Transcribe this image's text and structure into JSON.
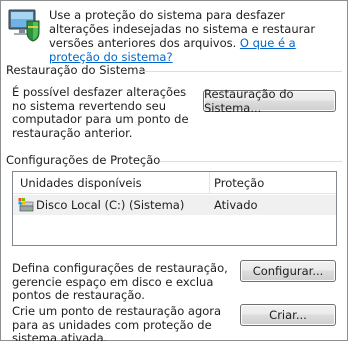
{
  "intro": {
    "text": "Use a proteção do sistema para desfazer alterações indesejadas no sistema e restaurar versões anteriores dos arquivos.",
    "link": "O que é a proteção do sistema?",
    "icon": "system-protection-icon"
  },
  "restore": {
    "title": "Restauração do Sistema",
    "description": "É possível desfazer alterações no sistema revertendo seu computador para um ponto de restauração anterior.",
    "button_label": "Restauração do Sistema..."
  },
  "protection": {
    "title": "Configurações de Proteção",
    "columns": [
      "Unidades disponíveis",
      "Proteção"
    ],
    "drives": [
      {
        "name": "Disco Local (C:) (Sistema)",
        "status": "Ativado",
        "icon": "local-disk-icon"
      }
    ],
    "configure_text": "Defina configurações de restauração, gerencie espaço em disco e exclua pontos de restauração.",
    "configure_label": "Configurar...",
    "create_text": "Crie um ponto de restauração agora para as unidades com proteção de sistema ativada.",
    "create_label": "Criar..."
  },
  "colors": {
    "link": "#0066cc",
    "separator": "#d5dfe5",
    "selected_row": "#f0f0f0"
  }
}
